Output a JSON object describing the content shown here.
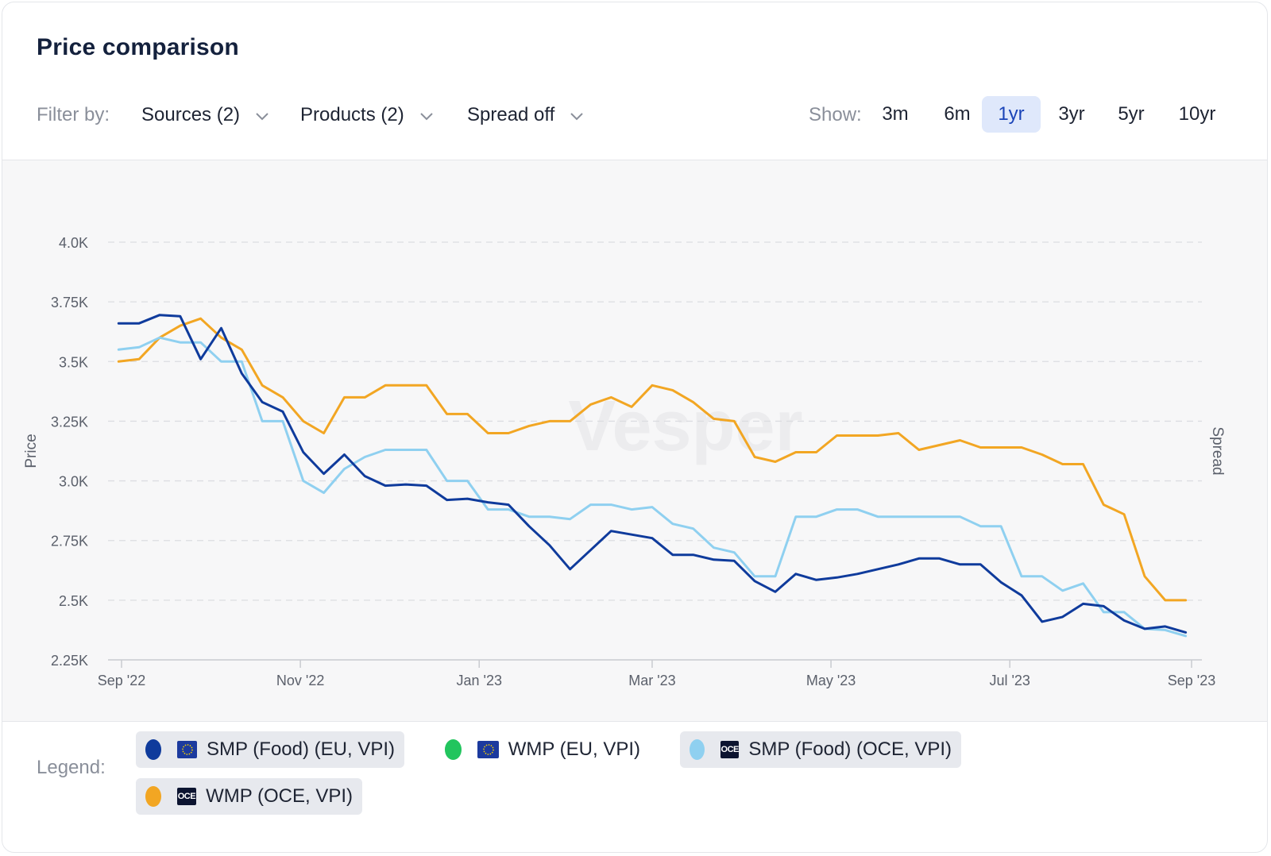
{
  "title": "Price comparison",
  "filters": {
    "label": "Filter by:",
    "sources": "Sources (2)",
    "products": "Products (2)",
    "spread": "Spread off"
  },
  "show": {
    "label": "Show:",
    "ranges": [
      "3m",
      "6m",
      "1yr",
      "3yr",
      "5yr",
      "10yr"
    ],
    "active": "1yr"
  },
  "watermark": "Vesper",
  "legend": {
    "label": "Legend:",
    "items": [
      {
        "label": "SMP (Food) (EU, VPI)",
        "color": "#0f3b9c",
        "flag": "eu",
        "flag_text": "",
        "active": true
      },
      {
        "label": "WMP (EU, VPI)",
        "color": "#22c55e",
        "flag": "eu",
        "flag_text": "",
        "active": false
      },
      {
        "label": "SMP (Food) (OCE, VPI)",
        "color": "#8fd0f0",
        "flag": "oce",
        "flag_text": "OCE",
        "active": true
      },
      {
        "label": "WMP (OCE, VPI)",
        "color": "#f2a623",
        "flag": "oce",
        "flag_text": "OCE",
        "active": true
      }
    ]
  },
  "chart_data": {
    "type": "line",
    "title": "",
    "xlabel": "",
    "ylabel": "Price",
    "y2label": "Spread",
    "ylim": [
      2250,
      4000
    ],
    "yticks": [
      2250,
      2500,
      2750,
      3000,
      3250,
      3500,
      3750,
      4000
    ],
    "ytick_labels": [
      "2.25K",
      "2.5K",
      "2.75K",
      "3.0K",
      "3.25K",
      "3.5K",
      "3.75K",
      "4.0K"
    ],
    "xlim": [
      "2022-09-01",
      "2023-09-01"
    ],
    "xticks": [
      "2022-09-01",
      "2022-11-01",
      "2023-01-01",
      "2023-03-01",
      "2023-05-01",
      "2023-07-01",
      "2023-09-01"
    ],
    "xtick_labels": [
      "Sep '22",
      "Nov '22",
      "Jan '23",
      "Mar '23",
      "May '23",
      "Jul '23",
      "Sep '23"
    ],
    "grid": true,
    "series": [
      {
        "name": "SMP (Food) (EU, VPI)",
        "color": "#0f3b9c",
        "x": [
          "2022-08-31",
          "2022-09-07",
          "2022-09-14",
          "2022-09-21",
          "2022-09-28",
          "2022-10-05",
          "2022-10-12",
          "2022-10-19",
          "2022-10-26",
          "2022-11-02",
          "2022-11-09",
          "2022-11-16",
          "2022-11-23",
          "2022-11-30",
          "2022-12-07",
          "2022-12-14",
          "2022-12-21",
          "2022-12-28",
          "2023-01-04",
          "2023-01-11",
          "2023-01-18",
          "2023-01-25",
          "2023-02-01",
          "2023-02-08",
          "2023-02-15",
          "2023-02-22",
          "2023-03-01",
          "2023-03-08",
          "2023-03-15",
          "2023-03-22",
          "2023-03-29",
          "2023-04-05",
          "2023-04-12",
          "2023-04-19",
          "2023-04-26",
          "2023-05-03",
          "2023-05-10",
          "2023-05-17",
          "2023-05-24",
          "2023-05-31",
          "2023-06-07",
          "2023-06-14",
          "2023-06-21",
          "2023-06-28",
          "2023-07-05",
          "2023-07-12",
          "2023-07-19",
          "2023-07-26",
          "2023-08-02",
          "2023-08-09",
          "2023-08-16",
          "2023-08-23",
          "2023-08-30"
        ],
        "y": [
          3660,
          3660,
          3695,
          3690,
          3510,
          3640,
          3450,
          3330,
          3290,
          3120,
          3030,
          3110,
          3020,
          2980,
          2985,
          2980,
          2920,
          2925,
          2910,
          2900,
          2810,
          2730,
          2630,
          2710,
          2790,
          2775,
          2760,
          2690,
          2690,
          2670,
          2665,
          2580,
          2535,
          2610,
          2585,
          2595,
          2610,
          2630,
          2650,
          2675,
          2675,
          2650,
          2650,
          2575,
          2520,
          2410,
          2430,
          2485,
          2475,
          2415,
          2380,
          2390,
          2365
        ]
      },
      {
        "name": "SMP (Food) (OCE, VPI)",
        "color": "#8fd0f0",
        "x": [
          "2022-08-31",
          "2022-09-07",
          "2022-09-14",
          "2022-09-21",
          "2022-09-28",
          "2022-10-05",
          "2022-10-12",
          "2022-10-19",
          "2022-10-26",
          "2022-11-02",
          "2022-11-09",
          "2022-11-16",
          "2022-11-23",
          "2022-11-30",
          "2022-12-07",
          "2022-12-14",
          "2022-12-21",
          "2022-12-28",
          "2023-01-04",
          "2023-01-11",
          "2023-01-18",
          "2023-01-25",
          "2023-02-01",
          "2023-02-08",
          "2023-02-15",
          "2023-02-22",
          "2023-03-01",
          "2023-03-08",
          "2023-03-15",
          "2023-03-22",
          "2023-03-29",
          "2023-04-05",
          "2023-04-12",
          "2023-04-19",
          "2023-04-26",
          "2023-05-03",
          "2023-05-10",
          "2023-05-17",
          "2023-05-24",
          "2023-05-31",
          "2023-06-07",
          "2023-06-14",
          "2023-06-21",
          "2023-06-28",
          "2023-07-05",
          "2023-07-12",
          "2023-07-19",
          "2023-07-26",
          "2023-08-02",
          "2023-08-09",
          "2023-08-16",
          "2023-08-23",
          "2023-08-30"
        ],
        "y": [
          3550,
          3560,
          3600,
          3580,
          3580,
          3500,
          3500,
          3250,
          3250,
          3000,
          2950,
          3050,
          3100,
          3130,
          3130,
          3130,
          3000,
          3000,
          2880,
          2880,
          2850,
          2850,
          2840,
          2900,
          2900,
          2880,
          2890,
          2820,
          2800,
          2720,
          2700,
          2600,
          2600,
          2850,
          2850,
          2880,
          2880,
          2850,
          2850,
          2850,
          2850,
          2850,
          2810,
          2810,
          2600,
          2600,
          2540,
          2570,
          2450,
          2450,
          2380,
          2375,
          2350
        ]
      },
      {
        "name": "WMP (OCE, VPI)",
        "color": "#f2a623",
        "x": [
          "2022-08-31",
          "2022-09-07",
          "2022-09-14",
          "2022-09-21",
          "2022-09-28",
          "2022-10-05",
          "2022-10-12",
          "2022-10-19",
          "2022-10-26",
          "2022-11-02",
          "2022-11-09",
          "2022-11-16",
          "2022-11-23",
          "2022-11-30",
          "2022-12-07",
          "2022-12-14",
          "2022-12-21",
          "2022-12-28",
          "2023-01-04",
          "2023-01-11",
          "2023-01-18",
          "2023-01-25",
          "2023-02-01",
          "2023-02-08",
          "2023-02-15",
          "2023-02-22",
          "2023-03-01",
          "2023-03-08",
          "2023-03-15",
          "2023-03-22",
          "2023-03-29",
          "2023-04-05",
          "2023-04-12",
          "2023-04-19",
          "2023-04-26",
          "2023-05-03",
          "2023-05-10",
          "2023-05-17",
          "2023-05-24",
          "2023-05-31",
          "2023-06-07",
          "2023-06-14",
          "2023-06-21",
          "2023-06-28",
          "2023-07-05",
          "2023-07-12",
          "2023-07-19",
          "2023-07-26",
          "2023-08-02",
          "2023-08-09",
          "2023-08-16",
          "2023-08-23",
          "2023-08-30"
        ],
        "y": [
          3500,
          3510,
          3600,
          3650,
          3680,
          3600,
          3550,
          3400,
          3350,
          3250,
          3200,
          3350,
          3350,
          3400,
          3400,
          3400,
          3280,
          3280,
          3200,
          3200,
          3230,
          3250,
          3250,
          3320,
          3350,
          3310,
          3400,
          3380,
          3330,
          3260,
          3250,
          3100,
          3080,
          3120,
          3120,
          3190,
          3190,
          3190,
          3200,
          3130,
          3150,
          3170,
          3140,
          3140,
          3140,
          3110,
          3070,
          3070,
          2900,
          2860,
          2600,
          2500,
          2500
        ]
      }
    ]
  }
}
